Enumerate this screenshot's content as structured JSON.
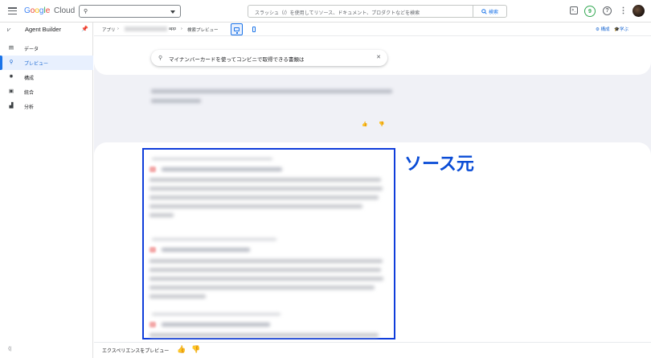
{
  "topbar": {
    "brand_google": "Google",
    "brand_cloud": "Cloud",
    "project_icon": "hub-icon",
    "search_placeholder": "スラッシュ（/）を使用してリソース、ドキュメント、プロダクトなどを検索",
    "search_button": "検索",
    "notification_count": "9",
    "icons": [
      "menu-icon",
      "terminal-icon",
      "help-icon",
      "more-vert-icon"
    ]
  },
  "sidebar": {
    "title": "Agent Builder",
    "items": [
      {
        "label": "データ",
        "icon": "data-icon"
      },
      {
        "label": "プレビュー",
        "icon": "search-icon",
        "active": true
      },
      {
        "label": "構成",
        "icon": "settings-icon"
      },
      {
        "label": "統合",
        "icon": "integration-icon"
      },
      {
        "label": "分析",
        "icon": "analytics-icon"
      }
    ]
  },
  "header": {
    "breadcrumb_root": "アプリ",
    "breadcrumb_suffix": "app",
    "breadcrumb_current": "検索プレビュー",
    "configure": "構成",
    "learn": "学ぶ"
  },
  "preview": {
    "query": "マイナンバーカードを使ってコンビニで取得できる書類は"
  },
  "annotation": {
    "source_label": "ソース元",
    "box_color": "#0f3ddb"
  },
  "bottombar": {
    "label": "エクスペリエンスをプレビュー"
  }
}
